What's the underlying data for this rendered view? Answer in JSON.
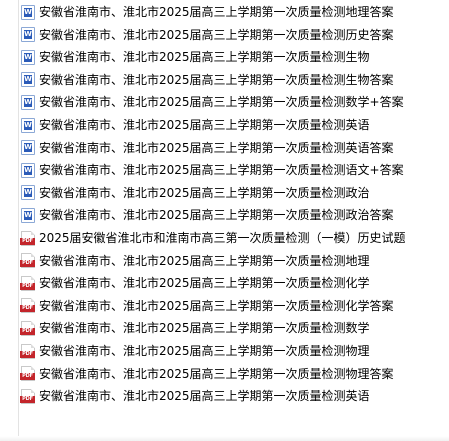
{
  "files": [
    {
      "name": "安徽省淮南市、淮北市2025届高三上学期第一次质量检测地理答案",
      "type": "word",
      "icon": "word-document-icon"
    },
    {
      "name": "安徽省淮南市、淮北市2025届高三上学期第一次质量检测历史答案",
      "type": "word",
      "icon": "word-document-icon"
    },
    {
      "name": "安徽省淮南市、淮北市2025届高三上学期第一次质量检测生物",
      "type": "word",
      "icon": "word-document-icon"
    },
    {
      "name": "安徽省淮南市、淮北市2025届高三上学期第一次质量检测生物答案",
      "type": "word",
      "icon": "word-document-icon"
    },
    {
      "name": "安徽省淮南市、淮北市2025届高三上学期第一次质量检测数学+答案",
      "type": "word",
      "icon": "word-document-icon"
    },
    {
      "name": "安徽省淮南市、淮北市2025届高三上学期第一次质量检测英语",
      "type": "word",
      "icon": "word-document-icon"
    },
    {
      "name": "安徽省淮南市、淮北市2025届高三上学期第一次质量检测英语答案",
      "type": "word",
      "icon": "word-document-icon"
    },
    {
      "name": "安徽省淮南市、淮北市2025届高三上学期第一次质量检测语文+答案",
      "type": "word",
      "icon": "word-document-icon"
    },
    {
      "name": "安徽省淮南市、淮北市2025届高三上学期第一次质量检测政治",
      "type": "word",
      "icon": "word-document-icon"
    },
    {
      "name": "安徽省淮南市、淮北市2025届高三上学期第一次质量检测政治答案",
      "type": "word",
      "icon": "word-document-icon"
    },
    {
      "name": "2025届安徽省淮北市和淮南市高三第一次质量检测（一模）历史试题",
      "type": "pdf",
      "icon": "pdf-document-icon"
    },
    {
      "name": "安徽省淮南市、淮北市2025届高三上学期第一次质量检测地理",
      "type": "pdf",
      "icon": "pdf-document-icon"
    },
    {
      "name": "安徽省淮南市、淮北市2025届高三上学期第一次质量检测化学",
      "type": "pdf",
      "icon": "pdf-document-icon"
    },
    {
      "name": "安徽省淮南市、淮北市2025届高三上学期第一次质量检测化学答案",
      "type": "pdf",
      "icon": "pdf-document-icon"
    },
    {
      "name": "安徽省淮南市、淮北市2025届高三上学期第一次质量检测数学",
      "type": "pdf",
      "icon": "pdf-document-icon"
    },
    {
      "name": "安徽省淮南市、淮北市2025届高三上学期第一次质量检测物理",
      "type": "pdf",
      "icon": "pdf-document-icon"
    },
    {
      "name": "安徽省淮南市、淮北市2025届高三上学期第一次质量检测物理答案",
      "type": "pdf",
      "icon": "pdf-document-icon"
    },
    {
      "name": "安徽省淮南市、淮北市2025届高三上学期第一次质量检测英语",
      "type": "pdf",
      "icon": "pdf-document-icon"
    }
  ]
}
